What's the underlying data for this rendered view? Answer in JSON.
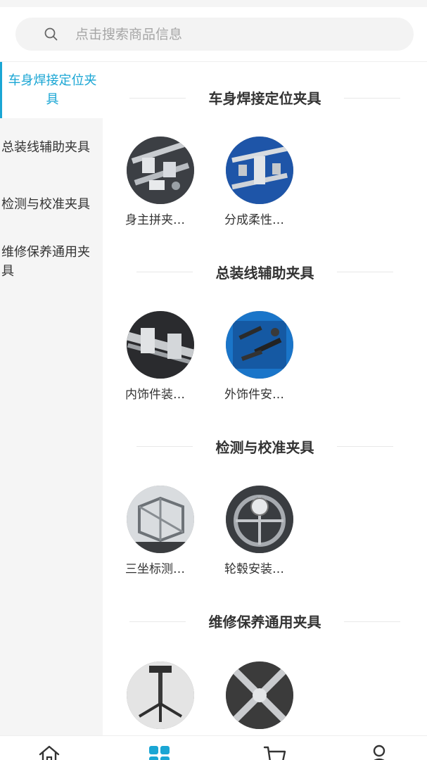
{
  "search": {
    "placeholder": "点击搜索商品信息"
  },
  "sidebar": {
    "items": [
      {
        "label": "车身焊接定位夹具",
        "active": true
      },
      {
        "label": "总装线辅助夹具",
        "active": false
      },
      {
        "label": "检测与校准夹具",
        "active": false
      },
      {
        "label": "维修保养通用夹具",
        "active": false
      }
    ]
  },
  "sections": [
    {
      "title": "车身焊接定位夹具",
      "products": [
        {
          "name": "身主拼夹…"
        },
        {
          "name": "分成柔性…"
        }
      ]
    },
    {
      "title": "总装线辅助夹具",
      "products": [
        {
          "name": "内饰件装…"
        },
        {
          "name": "外饰件安…"
        }
      ]
    },
    {
      "title": "检测与校准夹具",
      "products": [
        {
          "name": "三坐标测…"
        },
        {
          "name": "轮毂安装…"
        }
      ]
    },
    {
      "title": "维修保养通用夹具",
      "products": [
        {
          "name": ""
        },
        {
          "name": ""
        }
      ]
    }
  ],
  "nav": {
    "items": [
      {
        "icon": "home-icon"
      },
      {
        "icon": "category-icon",
        "active": true
      },
      {
        "icon": "cart-icon"
      },
      {
        "icon": "user-icon"
      }
    ]
  },
  "colors": {
    "accent": "#1aa6d4",
    "sidebar_bg": "#f5f5f5",
    "search_bg": "#f3f3f3"
  }
}
